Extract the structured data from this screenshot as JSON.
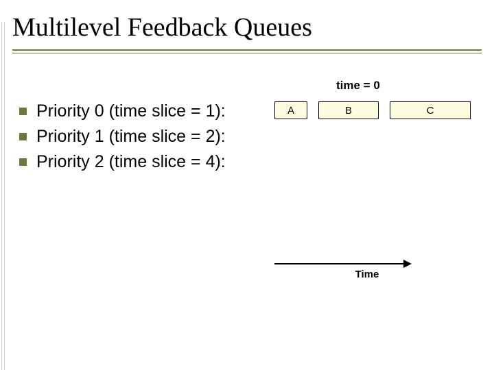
{
  "title": "Multilevel Feedback Queues",
  "time_label": "time = 0",
  "bullets": [
    {
      "text": "Priority 0 (time slice = 1):"
    },
    {
      "text": "Priority 1 (time slice = 2):"
    },
    {
      "text": "Priority 2 (time slice = 4):"
    }
  ],
  "queue": {
    "row0": [
      {
        "name": "A"
      },
      {
        "name": "B"
      },
      {
        "name": "C"
      }
    ]
  },
  "timeline_label": "Time",
  "colors": {
    "accent": "#6c7a40",
    "process_fill": "#fffde0"
  }
}
